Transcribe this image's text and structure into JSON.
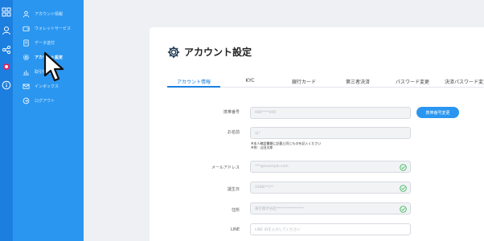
{
  "sidebar": {
    "items": [
      {
        "label": "アカウント情報",
        "icon": "user-icon"
      },
      {
        "label": "ウォレットサービス",
        "icon": "wallet-icon"
      },
      {
        "label": "データ送付",
        "icon": "document-icon"
      },
      {
        "label": "アカウント設定",
        "icon": "gear-icon",
        "active": true
      },
      {
        "label": "取引管理",
        "icon": "chart-icon"
      },
      {
        "label": "インボックス",
        "icon": "mail-icon"
      },
      {
        "label": "ログアウト",
        "icon": "logout-icon"
      }
    ]
  },
  "rail": {
    "icons": [
      "grid-icon",
      "user-icon",
      "share-icon",
      "record-icon",
      "info-icon"
    ]
  },
  "page": {
    "title": "アカウント設定"
  },
  "tabs": [
    {
      "label": "アカウント情報",
      "active": true
    },
    {
      "label": "KYC"
    },
    {
      "label": "銀行カード"
    },
    {
      "label": "第三者決済"
    },
    {
      "label": "パスワード変更"
    },
    {
      "label": "決済パスワード変更"
    }
  ],
  "form": {
    "phone": {
      "label": "携帯番号",
      "value": "080****000"
    },
    "name": {
      "label": "お名前",
      "value": "山*"
    },
    "name_note_1": "※本人確認書類に記載と同じものを記入ください",
    "name_note_2": "※例：山田太郎",
    "email": {
      "label": "メールアドレス",
      "value": "***@example.com"
    },
    "birthday": {
      "label": "誕生日",
      "value": "1988/**/**"
    },
    "address": {
      "label": "住所",
      "value": "東京都渋谷区***************"
    },
    "line": {
      "label": "LINE",
      "placeholder": "LINE IDを入力してください"
    },
    "change_phone_button": "携帯番号変更"
  },
  "colors": {
    "rail": "#1c7fe0",
    "sidebar": "#2a96f0",
    "accent": "#1c7fe0",
    "check": "#2bb24c"
  }
}
